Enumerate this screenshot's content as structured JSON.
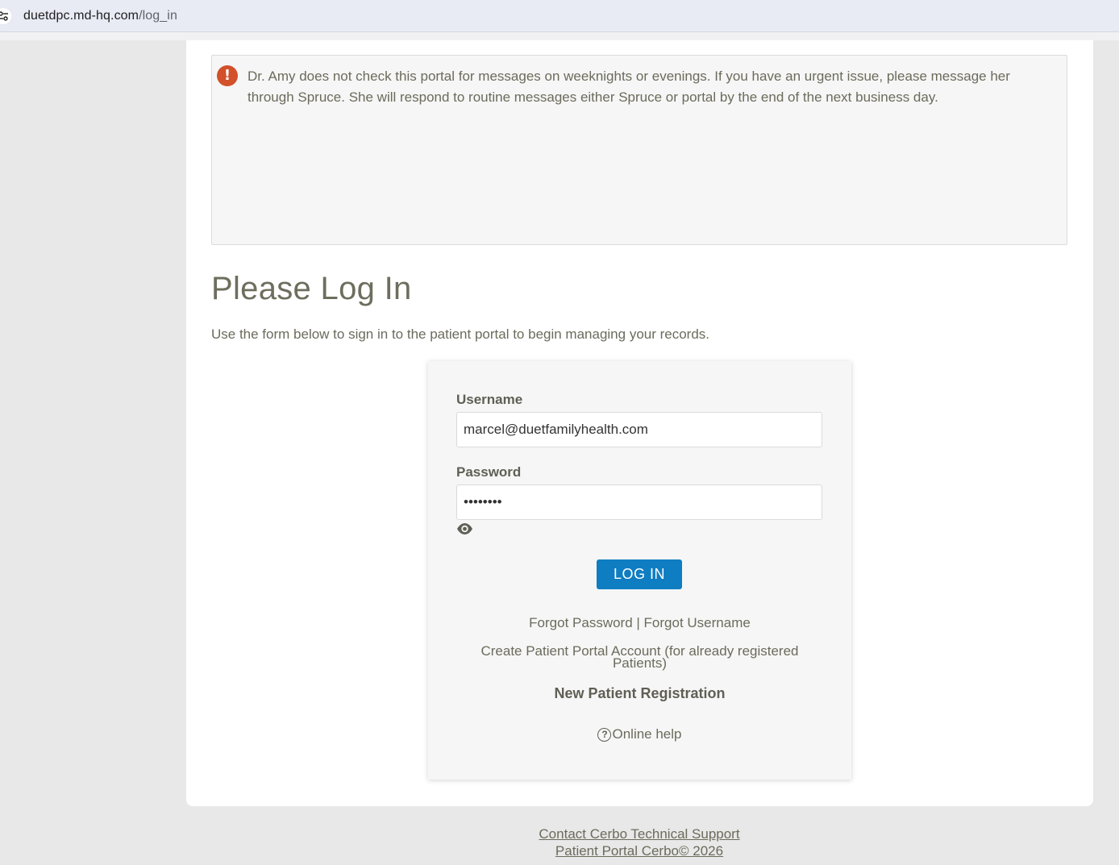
{
  "browser": {
    "url_host": "duetdpc.md-hq.com",
    "url_path": "/log_in",
    "site_info_icon": "tune-icon"
  },
  "notice": {
    "icon": "alert-circle-icon",
    "icon_color": "#d2502a",
    "text": "Dr. Amy does not check this portal for messages on weeknights or evenings.  If you have an urgent issue, please message her through Spruce.  She will respond to routine messages either Spruce or portal by the end of the next business day."
  },
  "page": {
    "title": "Please Log In",
    "intro": "Use the form below to sign in to the patient portal to begin managing your records."
  },
  "login": {
    "username_label": "Username",
    "username_value": "marcel@duetfamilyhealth.com",
    "password_label": "Password",
    "password_value": "••••••••",
    "show_password_icon": "eye-icon",
    "submit_label": "LOG IN",
    "button_color": "#0f7dc2",
    "forgot_password": "Forgot Password",
    "separator": " | ",
    "forgot_username": "Forgot Username",
    "create_account": "Create Patient Portal Account (for already registered Patients)",
    "new_patient": "New Patient Registration",
    "help_icon": "question-circle-icon",
    "online_help": "Online help"
  },
  "footer": {
    "support_link": "Contact Cerbo Technical Support",
    "copyright": "Patient Portal Cerbo© 2026"
  }
}
